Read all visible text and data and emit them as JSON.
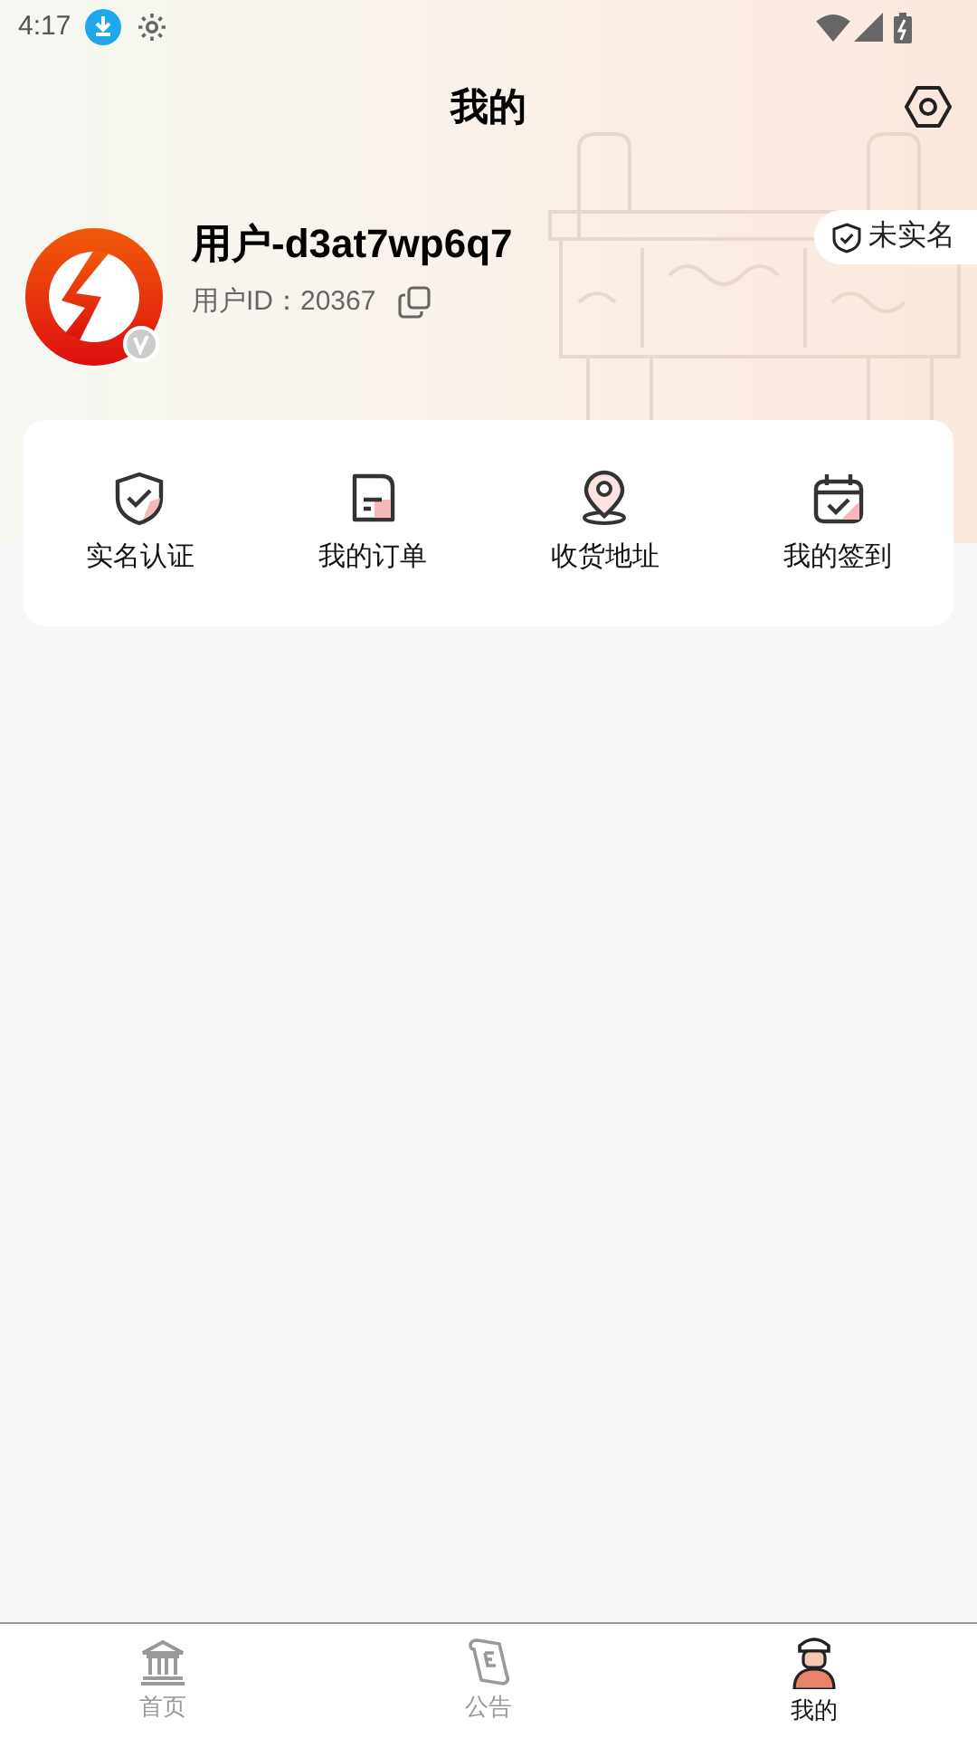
{
  "status_bar": {
    "time": "4:17"
  },
  "header": {
    "title": "我的"
  },
  "profile": {
    "username": "用户-d3at7wp6q7",
    "user_id": "用户ID：20367",
    "verify_badge": {
      "label": "未实名",
      "verified": false
    }
  },
  "shortcuts": [
    {
      "label": "实名认证",
      "kind": "shield"
    },
    {
      "label": "我的订单",
      "kind": "order"
    },
    {
      "label": "收货地址",
      "kind": "location"
    },
    {
      "label": "我的签到",
      "kind": "calendar"
    }
  ],
  "tab_bar": [
    {
      "label": "首页",
      "kind": "home",
      "selected": false
    },
    {
      "label": "公告",
      "kind": "notice",
      "selected": false
    },
    {
      "label": "我的",
      "kind": "me",
      "selected": true
    }
  ]
}
